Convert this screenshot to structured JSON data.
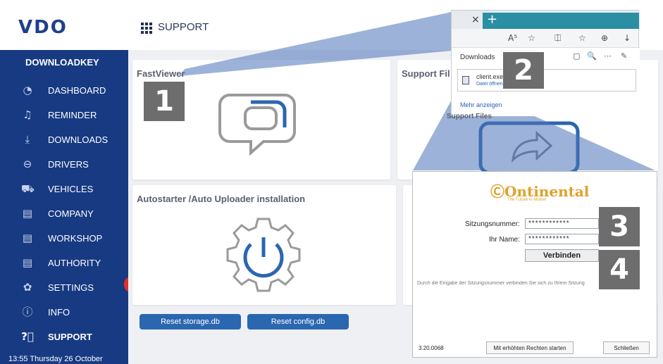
{
  "app": {
    "logo": "VDO",
    "page_title": "SUPPORT"
  },
  "sidebar": {
    "title": "DOWNLOADKEY",
    "items": [
      {
        "label": "DASHBOARD",
        "icon": "dashboard-gauge-icon"
      },
      {
        "label": "REMINDER",
        "icon": "bell-icon"
      },
      {
        "label": "DOWNLOADS",
        "icon": "download-icon"
      },
      {
        "label": "DRIVERS",
        "icon": "steering-wheel-icon"
      },
      {
        "label": "VEHICLES",
        "icon": "truck-icon"
      },
      {
        "label": "COMPANY",
        "icon": "card-icon"
      },
      {
        "label": "WORKSHOP",
        "icon": "card-icon"
      },
      {
        "label": "AUTHORITY",
        "icon": "card-icon"
      },
      {
        "label": "SETTINGS",
        "icon": "gear-icon"
      },
      {
        "label": "INFO",
        "icon": "info-icon"
      },
      {
        "label": "SUPPORT",
        "icon": "question-icon",
        "active": true
      }
    ],
    "clock": "13:55 Thursday 26 October"
  },
  "cards": {
    "fastviewer": "FastViewer",
    "support_files": "Support Fil",
    "support_files_partial": "Support Files",
    "autostarter": "Autostarter /Auto Uploader installation"
  },
  "buttons": {
    "reset_storage": "Reset storage.db",
    "reset_config": "Reset config.db"
  },
  "callouts": [
    "1",
    "2",
    "3",
    "4"
  ],
  "browser": {
    "close_glyph": "×",
    "new_tab_glyph": "+",
    "toolbar_icons": [
      "A⁵",
      "☆",
      "⎅",
      "☆",
      "⊕",
      "↓"
    ],
    "downloads_title": "Downloads",
    "panel_icons": [
      "▢",
      "🔍",
      "⋯",
      "✎"
    ],
    "file_name": "client.exe",
    "file_link": "Datei öffnen",
    "more": "Mehr anzeigen"
  },
  "dialog": {
    "brand": "Ontinental",
    "brand_sub": "The Future in Motion",
    "session_label": "Sitzungsnummer:",
    "session_value": "************",
    "name_label": "Ihr Name:",
    "name_value": "************",
    "connect": "Verbinden",
    "hint": "Durch die Eingabe der Sitzungsnummer verbinden Sie sich zu Ihrem Sitzung",
    "version": "3.20.0068",
    "elevated": "Mit erhöhten Rechten starten",
    "close": "Schließen"
  },
  "colors": {
    "sidebar": "#173a82",
    "accent_button": "#2b66b0",
    "callout_bg": "#6d6d6d",
    "overlay": "#5b7fbf",
    "brand_orange": "#e0a12a"
  }
}
